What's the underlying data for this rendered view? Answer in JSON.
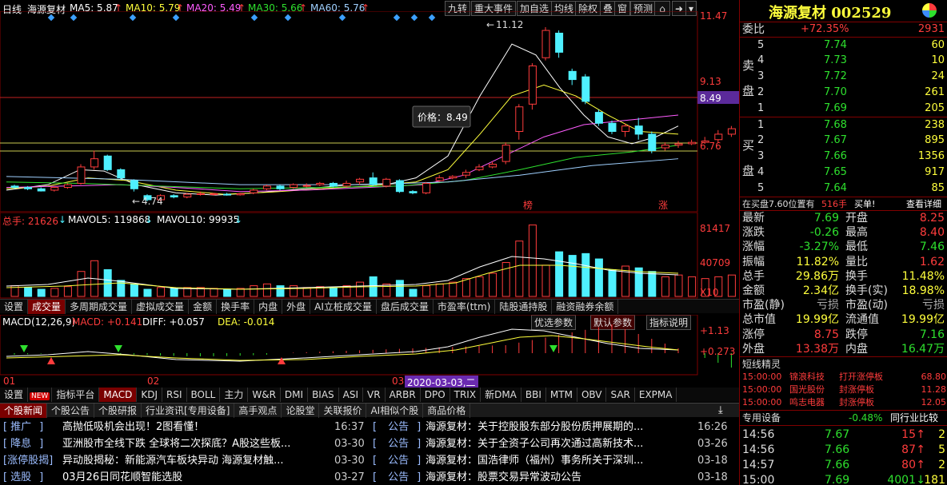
{
  "header": {
    "period": "日线",
    "stock_name": "海源复材",
    "ma5": "MA5: 5.87",
    "ma10": "MA10: 5.79",
    "ma20": "MA20: 5.49",
    "ma30": "MA30: 5.66",
    "ma60": "MA60: 5.76",
    "up_arrow": "↑",
    "toolbar": [
      "九转",
      "重大事件",
      "加自选",
      "均线",
      "除权",
      "叠",
      "窗",
      "预测"
    ]
  },
  "kline": {
    "price_ticks": [
      "11.47",
      "9.13",
      "8.49",
      "6.76"
    ],
    "high_label": "11.12",
    "low_label": "4.74",
    "tooltip": "价格：8.49",
    "marker_bang": "榜",
    "marker_zhang": "涨",
    "colors": {
      "up": "#ff3c3c",
      "down": "#4ff0ff",
      "ma5": "#ffffff",
      "ma10": "#ffff3c",
      "ma20": "#ff5cff",
      "ma30": "#2ee02e",
      "ma60": "#9fd0ff"
    }
  },
  "volume": {
    "total": "总手: 21626",
    "mavol5": "MAVOL5: 119868",
    "mavol10": "MAVOL10: 99935",
    "down_arrow": "↓",
    "ticks": [
      "81417",
      "40709",
      "X10"
    ]
  },
  "indicator_tabs": [
    "设置",
    "成交量",
    "多周期成交量",
    "虚拟成交量",
    "金额",
    "换手率",
    "内盘",
    "外盘",
    "AI立桩成交量",
    "盘后成交量",
    "市盈率(ttm)",
    "陆股通持股",
    "融资融券余额"
  ],
  "macd": {
    "title": "MACD(12,26,9)",
    "macd_val": "MACD: +0.141",
    "diff_val": "DIFF: +0.057",
    "dea_val": "DEA: -0.014",
    "btn_opt": "优选参数",
    "btn_default": "默认参数",
    "btn_help": "指标说明",
    "ticks": [
      "+1.13",
      "+0.273"
    ]
  },
  "date_axis": {
    "m1": "01",
    "m2": "02",
    "m3": "03",
    "cursor": "2020-03-03,二"
  },
  "bottom_tabs": [
    "设置",
    "NEW",
    "指标平台",
    "MACD",
    "KDJ",
    "RSI",
    "BOLL",
    "主力",
    "W&R",
    "DMI",
    "BIAS",
    "ASI",
    "VR",
    "ARBR",
    "DPO",
    "TRIX",
    "新DMA",
    "BBI",
    "MTM",
    "OBV",
    "SAR",
    "EXPMA"
  ],
  "news_tabs": [
    "个股新闻",
    "个股公告",
    "个股研报",
    "行业资讯[专用设备]",
    "高手观点",
    "论股堂",
    "关联报价",
    "AI相似个股",
    "商品价格"
  ],
  "news_left": [
    {
      "tag": "推广",
      "title": "高抛低吸机会出现！2图看懂！",
      "time": "16:37"
    },
    {
      "tag": "降息",
      "title": "亚洲股市全线下跌 全球将二次探底？A股这些板...",
      "time": "03-30"
    },
    {
      "tag": "涨停股揭",
      "title": "异动股揭秘：新能源汽车板块异动 海源复材触...",
      "time": "03-30"
    },
    {
      "tag": "选股",
      "title": "03月26日同花顺智能选股",
      "time": "03-27"
    }
  ],
  "news_right": [
    {
      "tag": "公告",
      "title": "海源复材：关于控股股东部分股份质押展期的...",
      "time": "16:26"
    },
    {
      "tag": "公告",
      "title": "海源复材：关于全资子公司再次通过高新技术...",
      "time": "03-26"
    },
    {
      "tag": "公告",
      "title": "海源复材：国浩律师（福州）事务所关于深圳...",
      "time": "03-18"
    },
    {
      "tag": "公告",
      "title": "海源复材：股票交易异常波动公告",
      "time": "03-18"
    }
  ],
  "quote": {
    "title": "海源复材 002529",
    "weibi_label": "委比",
    "weibi_val": "+72.35%",
    "weibi_num": "2931",
    "sell_label_1": "卖",
    "sell_label_2": "盘",
    "buy_label_1": "买",
    "buy_label_2": "盘",
    "sells": [
      {
        "lvl": "5",
        "price": "7.74",
        "vol": "60"
      },
      {
        "lvl": "4",
        "price": "7.73",
        "vol": "10"
      },
      {
        "lvl": "3",
        "price": "7.72",
        "vol": "24"
      },
      {
        "lvl": "2",
        "price": "7.70",
        "vol": "261"
      },
      {
        "lvl": "1",
        "price": "7.69",
        "vol": "205"
      }
    ],
    "buys": [
      {
        "lvl": "1",
        "price": "7.68",
        "vol": "238"
      },
      {
        "lvl": "2",
        "price": "7.67",
        "vol": "895"
      },
      {
        "lvl": "3",
        "price": "7.66",
        "vol": "1356"
      },
      {
        "lvl": "4",
        "price": "7.65",
        "vol": "917"
      },
      {
        "lvl": "5",
        "price": "7.64",
        "vol": "85"
      }
    ],
    "notice": "在买盘7.60位置有",
    "notice_vol": "516手",
    "notice_act": "买单!",
    "notice_link": "查看详细",
    "stats": [
      {
        "l1": "最新",
        "v1": "7.69",
        "c1": "green",
        "l2": "开盘",
        "v2": "8.25",
        "c2": "red"
      },
      {
        "l1": "涨跌",
        "v1": "-0.26",
        "c1": "green",
        "l2": "最高",
        "v2": "8.40",
        "c2": "red"
      },
      {
        "l1": "涨幅",
        "v1": "-3.27%",
        "c1": "green",
        "l2": "最低",
        "v2": "7.46",
        "c2": "green"
      },
      {
        "l1": "振幅",
        "v1": "11.82%",
        "c1": "yellow",
        "l2": "量比",
        "v2": "1.62",
        "c2": "red"
      },
      {
        "l1": "总手",
        "v1": "29.86万",
        "c1": "yellow",
        "l2": "换手",
        "v2": "11.48%",
        "c2": "yellow"
      },
      {
        "l1": "金额",
        "v1": "2.34亿",
        "c1": "yellow",
        "l2": "换手(实)",
        "v2": "18.98%",
        "c2": "yellow"
      },
      {
        "l1": "市盈(静)",
        "v1": "亏损",
        "c1": "gray",
        "l2": "市盈(动)",
        "v2": "亏损",
        "c2": "gray"
      },
      {
        "l1": "总市值",
        "v1": "19.99亿",
        "c1": "yellow",
        "l2": "流通值",
        "v2": "19.99亿",
        "c2": "yellow"
      },
      {
        "l1": "涨停",
        "v1": "8.75",
        "c1": "red",
        "l2": "跌停",
        "v2": "7.16",
        "c2": "green"
      },
      {
        "l1": "外盘",
        "v1": "13.38万",
        "c1": "red",
        "l2": "内盘",
        "v2": "16.47万",
        "c2": "green"
      }
    ],
    "shortline_title": "短线精灵",
    "shortline": [
      {
        "time": "15:00:00",
        "name": "锦浪科技",
        "event": "打开涨停板",
        "val": "68.80"
      },
      {
        "time": "15:00:00",
        "name": "国光股份",
        "event": "封涨停板",
        "val": "11.28"
      },
      {
        "time": "15:00:00",
        "name": "鸣志电器",
        "event": "封涨停板",
        "val": "12.05"
      }
    ],
    "industry_label": "专用设备",
    "industry_pct": "-0.48%",
    "industry_compare": "同行业比较",
    "ticks": [
      {
        "time": "14:56",
        "price": "7.67",
        "vol": "15",
        "dir": "↑",
        "n": "2"
      },
      {
        "time": "14:56",
        "price": "7.66",
        "vol": "87",
        "dir": "↑",
        "n": "5"
      },
      {
        "time": "14:57",
        "price": "7.66",
        "vol": "80",
        "dir": "↑",
        "n": "2"
      },
      {
        "time": "15:00",
        "price": "7.69",
        "vol": "4001",
        "dir": "↓",
        "n": "181"
      }
    ]
  }
}
